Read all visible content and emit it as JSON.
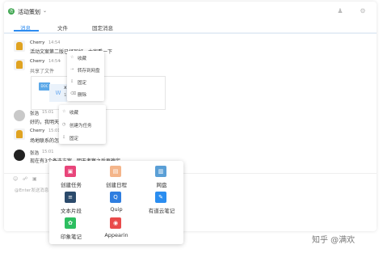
{
  "header": {
    "group_badge": "活",
    "title": "活动策划",
    "title_chevron": "⌄",
    "icons": {
      "members": "person-icon",
      "settings": "gear-icon"
    }
  },
  "tabs": [
    {
      "label": "消息",
      "active": true
    },
    {
      "label": "文件",
      "active": false
    },
    {
      "label": "固定消息",
      "active": false
    }
  ],
  "messages": [
    {
      "sender": "Cherry",
      "time": "14:54",
      "text": "活动文案第二版已经写好，大家看一下"
    },
    {
      "sender": "Cherry",
      "time": "14:54",
      "text": "共享了文件",
      "chevron": "⌄"
    },
    {
      "sender": "张浩",
      "time": "15:01",
      "text": "好的，我明天"
    },
    {
      "sender": "Cherry",
      "time": "15:01",
      "text": "场地联系的怎"
    },
    {
      "sender": "张浩",
      "time": "15:01",
      "text": "现在有3个备选方案，明天考察之后再确定。"
    }
  ],
  "file_card": {
    "doc_badge": "DOC",
    "thumb_letter": "W",
    "name": "x",
    "size": "11"
  },
  "context_menu_file": [
    {
      "icon": "☆",
      "icon_name": "star-icon",
      "label": "收藏"
    },
    {
      "icon": "⇢",
      "icon_name": "forward-icon",
      "label": "转存到网盘"
    },
    {
      "icon": "⇩",
      "icon_name": "pin-icon",
      "label": "固定"
    },
    {
      "icon": "⌫",
      "icon_name": "trash-icon",
      "label": "删除"
    }
  ],
  "context_menu_text": [
    {
      "icon": "☆",
      "icon_name": "star-icon",
      "label": "收藏"
    },
    {
      "icon": "◷",
      "icon_name": "task-icon",
      "label": "创建为任务"
    },
    {
      "icon": "⇩",
      "icon_name": "pin-icon",
      "label": "固定"
    }
  ],
  "composer": {
    "hint": "@Enter发送消息",
    "icons": [
      "emoji-icon",
      "attach-icon",
      "image-icon"
    ]
  },
  "apps_panel": [
    {
      "label": "创建任务",
      "icon_name": "task-icon",
      "color": "#e8457a",
      "glyph": "▣"
    },
    {
      "label": "创建日程",
      "icon_name": "calendar-icon",
      "color": "#f4b58a",
      "glyph": "▤"
    },
    {
      "label": "网盘",
      "icon_name": "folder-icon",
      "color": "#5a9fd6",
      "glyph": "▥"
    },
    {
      "label": "文本片段",
      "icon_name": "snippet-icon",
      "color": "#2b4a6b",
      "glyph": "≡"
    },
    {
      "label": "Quip",
      "icon_name": "quip-icon",
      "color": "#2f7ee0",
      "glyph": "Q"
    },
    {
      "label": "有道云笔记",
      "icon_name": "youdao-note-icon",
      "color": "#2a8df0",
      "glyph": "✎"
    },
    {
      "label": "印象笔记",
      "icon_name": "evernote-icon",
      "color": "#2dbe60",
      "glyph": "✿"
    },
    {
      "label": "Appearin",
      "icon_name": "appearin-icon",
      "color": "#e94b4b",
      "glyph": "◉"
    }
  ],
  "watermark": "知乎 @满欢"
}
